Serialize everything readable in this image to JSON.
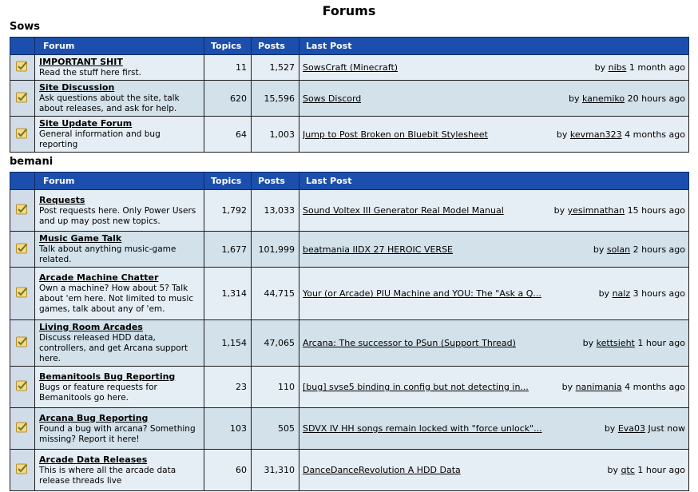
{
  "page_title": "Forums",
  "headers": {
    "forum": "Forum",
    "topics": "Topics",
    "posts": "Posts",
    "last_post": "Last Post"
  },
  "by_label": "by",
  "categories": [
    {
      "title": "Sows",
      "forums": [
        {
          "name": "IMPORTANT SHIT",
          "desc": "Read the stuff here first.",
          "topics": "11",
          "posts": "1,527",
          "last_title": "SowsCraft (Minecraft)",
          "last_user": "nibs",
          "last_time": "1 month ago"
        },
        {
          "name": "Site Discussion",
          "desc": "Ask questions about the site, talk about releases, and ask for help.",
          "topics": "620",
          "posts": "15,596",
          "last_title": "Sows Discord",
          "last_user": "kanemiko",
          "last_time": "20 hours ago"
        },
        {
          "name": "Site Update Forum",
          "desc": "General information and bug reporting",
          "topics": "64",
          "posts": "1,003",
          "last_title": "Jump to Post Broken on Bluebit Stylesheet",
          "last_user": "kevman323",
          "last_time": "4 months ago"
        }
      ]
    },
    {
      "title": "bemani",
      "forums": [
        {
          "name": "Requests",
          "desc": "Post requests here. Only Power Users and up may post new topics.",
          "topics": "1,792",
          "posts": "13,033",
          "last_title": "Sound Voltex III Generator Real Model Manual",
          "last_user": "yesimnathan",
          "last_time": "15 hours ago"
        },
        {
          "name": "Music Game Talk",
          "desc": "Talk about anything music-game related.",
          "topics": "1,677",
          "posts": "101,999",
          "last_title": "beatmania IIDX 27 HEROIC VERSE",
          "last_user": "solan",
          "last_time": "2 hours ago"
        },
        {
          "name": "Arcade Machine Chatter",
          "desc": "Own a machine? How about 5? Talk about 'em here. Not limited to music games, talk about any of 'em.",
          "topics": "1,314",
          "posts": "44,715",
          "last_title": "Your (or Arcade) PIU Machine and YOU: The \"Ask a Q...",
          "last_user": "nalz",
          "last_time": "3 hours ago"
        },
        {
          "name": "Living Room Arcades",
          "desc": "Discuss released HDD data, controllers, and get Arcana support here.",
          "topics": "1,154",
          "posts": "47,065",
          "last_title": "Arcana: The successor to PSun (Support Thread)",
          "last_user": "kettsieht",
          "last_time": "1 hour ago"
        },
        {
          "name": "Bemanitools Bug Reporting",
          "desc": "Bugs or feature requests for Bemanitools go here.",
          "topics": "23",
          "posts": "110",
          "last_title": "[bug] svse5 binding in config but not detecting in...",
          "last_user": "nanimania",
          "last_time": "4 months ago"
        },
        {
          "name": "Arcana Bug Reporting",
          "desc": "Found a bug with arcana? Something missing? Report it here!",
          "topics": "103",
          "posts": "505",
          "last_title": "SDVX IV HH songs remain locked with \"force unlock\"...",
          "last_user": "Eva03",
          "last_time": "Just now"
        },
        {
          "name": "Arcade Data Releases",
          "desc": "This is where all the arcade data release threads live",
          "topics": "60",
          "posts": "31,310",
          "last_title": "DanceDanceRevolution A HDD Data",
          "last_user": "qtc",
          "last_time": "1 hour ago"
        }
      ]
    }
  ]
}
